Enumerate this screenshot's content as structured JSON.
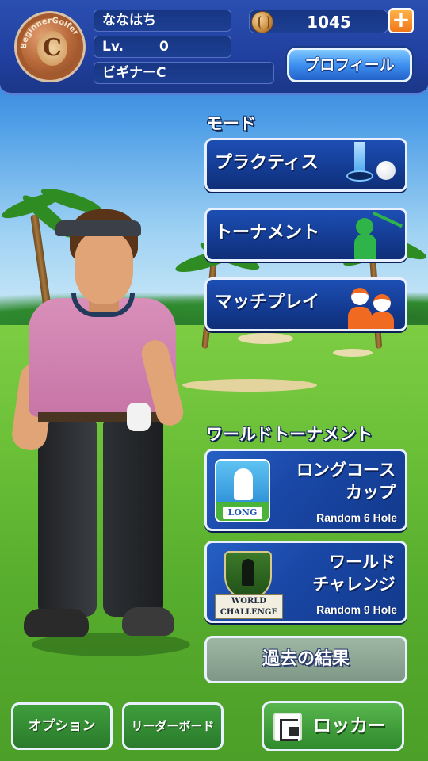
{
  "header": {
    "player_name": "ななはち",
    "level_label": "Lv.",
    "level_value": "0",
    "rank_title": "ビギナーC",
    "rank_badge_letter": "C",
    "rank_badge_text": "BeginnerGolfer",
    "coins": "1045",
    "plus_label": "+",
    "profile_label": "プロフィール"
  },
  "mode": {
    "section_label": "モード",
    "practice_label": "プラクティス",
    "tournament_label": "トーナメント",
    "match_label": "マッチプレイ"
  },
  "world": {
    "section_label": "ワールドトーナメント",
    "long_course": {
      "title_line1": "ロングコース",
      "title_line2": "カップ",
      "subtitle": "Random 6 Hole",
      "emblem_text": "LONG"
    },
    "world_challenge": {
      "title_line1": "ワールド",
      "title_line2": "チャレンジ",
      "subtitle": "Random 9 Hole",
      "emblem_line1": "WORLD",
      "emblem_line2": "CHALLENGE"
    },
    "history_label": "過去の結果"
  },
  "footer": {
    "option_label": "オプション",
    "leaderboard_label": "リーダーボード",
    "locker_label": "ロッカー"
  },
  "colors": {
    "header_bg": "#2140a0",
    "mode_button_bg": "#143c94",
    "plus_button": "#f0771a",
    "green_button": "#2f8a2c",
    "history_button": "#8fa795"
  }
}
